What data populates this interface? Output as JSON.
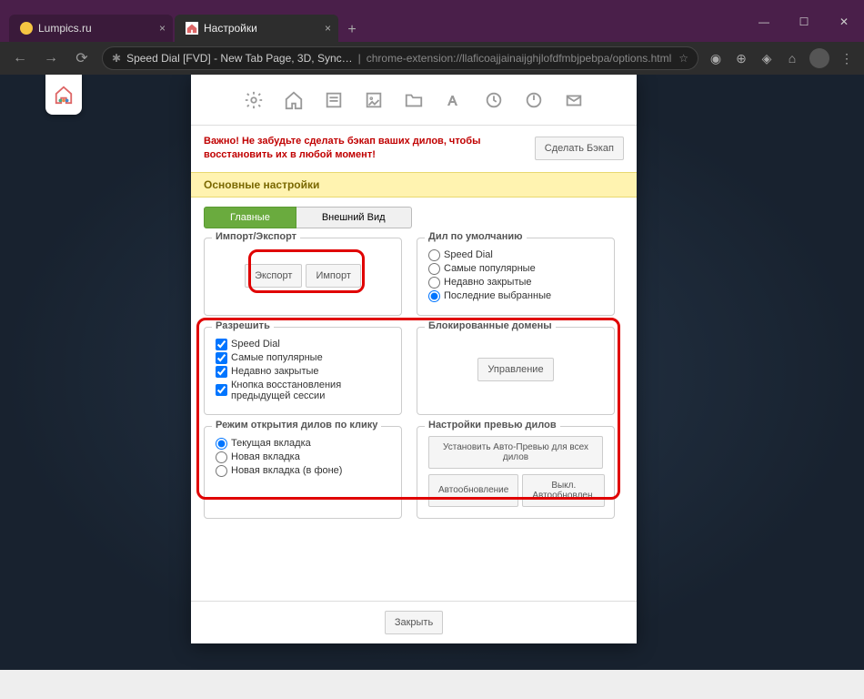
{
  "browser": {
    "tabs": [
      {
        "title": "Lumpics.ru",
        "active": false
      },
      {
        "title": "Настройки",
        "active": true
      }
    ],
    "url_ext": "Speed Dial [FVD] - New Tab Page, 3D, Sync…",
    "url_path": "chrome-extension://llaficoajjainaijghjlofdfmbjpebpa/options.html"
  },
  "warn": "Важно! Не забудьте сделать бэкап ваших дилов, чтобы восстановить их в любой момент!",
  "backup_btn": "Сделать Бэкап",
  "section_title": "Основные настройки",
  "subtabs": {
    "main": "Главные",
    "appearance": "Внешний Вид"
  },
  "fs_import": {
    "legend": "Импорт/Экспорт",
    "export": "Экспорт",
    "import": "Импорт"
  },
  "fs_default": {
    "legend": "Дил по умолчанию",
    "options": [
      "Speed Dial",
      "Самые популярные",
      "Недавно закрытые",
      "Последние выбранные"
    ]
  },
  "fs_allow": {
    "legend": "Разрешить",
    "options": [
      "Speed Dial",
      "Самые популярные",
      "Недавно закрытые",
      "Кнопка восстановления предыдущей сессии"
    ]
  },
  "fs_blocked": {
    "legend": "Блокированные домены",
    "manage": "Управление"
  },
  "fs_open": {
    "legend": "Режим открытия дилов по клику",
    "options": [
      "Текущая вкладка",
      "Новая вкладка",
      "Новая вкладка (в фоне)"
    ]
  },
  "fs_preview": {
    "legend": "Настройки превью дилов",
    "set_all": "Установить Авто-Превью для всех дилов",
    "auto_on": "Автообновление",
    "auto_off": "Выкл. Автообновлен."
  },
  "close_btn": "Закрыть"
}
